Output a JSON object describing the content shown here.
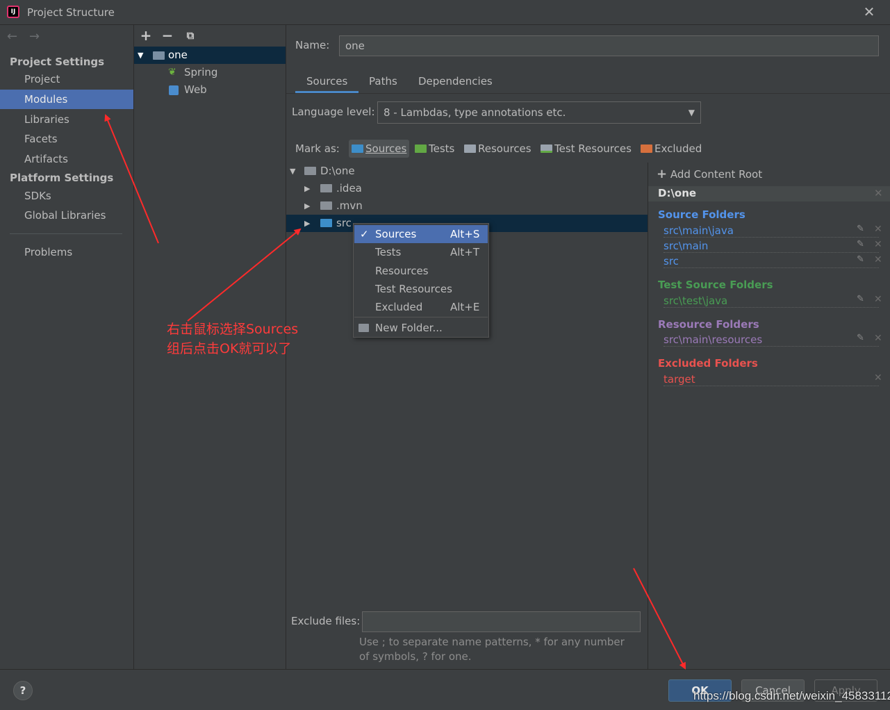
{
  "window": {
    "title": "Project Structure",
    "logo_text": "IJ"
  },
  "sidebar": {
    "project_settings_header": "Project Settings",
    "platform_settings_header": "Platform Settings",
    "items": [
      "Project",
      "Modules",
      "Libraries",
      "Facets",
      "Artifacts"
    ],
    "platform_items": [
      "SDKs",
      "Global Libraries"
    ],
    "problems": "Problems",
    "selected": "Modules"
  },
  "module_tree": {
    "toolbar": {
      "add": "+",
      "remove": "−"
    },
    "root": "one",
    "children": [
      "Spring",
      "Web"
    ]
  },
  "module": {
    "name_label": "Name:",
    "name_value": "one",
    "tabs": [
      "Sources",
      "Paths",
      "Dependencies"
    ],
    "active_tab": "Sources",
    "language_label": "Language level:",
    "language_value": "8 - Lambdas, type annotations etc.",
    "mark_as_label": "Mark as:",
    "mark_buttons": [
      {
        "label": "Sources",
        "color": "#3d8ec9"
      },
      {
        "label": "Tests",
        "color": "#62a844"
      },
      {
        "label": "Resources",
        "color": "#9aa3ad"
      },
      {
        "label": "Test Resources",
        "color": "#9aa3ad"
      },
      {
        "label": "Excluded",
        "color": "#d6703d"
      }
    ]
  },
  "file_tree": {
    "root": "D:\\one",
    "children": [
      ".idea",
      ".mvn",
      "src"
    ],
    "selected": "src"
  },
  "context_menu": {
    "items": [
      {
        "label": "Sources",
        "shortcut": "Alt+S",
        "checked": "✓"
      },
      {
        "label": "Tests",
        "shortcut": "Alt+T"
      },
      {
        "label": "Resources",
        "shortcut": ""
      },
      {
        "label": "Test Resources",
        "shortcut": ""
      },
      {
        "label": "Excluded",
        "shortcut": "Alt+E"
      }
    ],
    "new_folder": "New Folder..."
  },
  "content_root": {
    "add_label": "Add Content Root",
    "root_path": "D:\\one",
    "source_title": "Source Folders",
    "source_folders": [
      "src\\main\\java",
      "src\\main",
      "src"
    ],
    "test_title": "Test Source Folders",
    "test_folders": [
      "src\\test\\java"
    ],
    "resource_title": "Resource Folders",
    "resource_folders": [
      "src\\main\\resources"
    ],
    "excluded_title": "Excluded Folders",
    "excluded_folders": [
      "target"
    ],
    "colors": {
      "source": "#5394ec",
      "test": "#499c54",
      "resource": "#9b7ab8",
      "excluded": "#e8524f"
    }
  },
  "exclude": {
    "label": "Exclude files:",
    "hint": "Use ; to separate name patterns, * for any number of symbols, ? for one."
  },
  "buttons": {
    "help": "?",
    "ok": "OK",
    "cancel": "Cancel",
    "apply": "Apply"
  },
  "annotation": {
    "line1": "右击鼠标选择Sources",
    "line2": "组后点击OK就可以了"
  },
  "watermark": "https://blog.csdn.net/weixin_45833112"
}
